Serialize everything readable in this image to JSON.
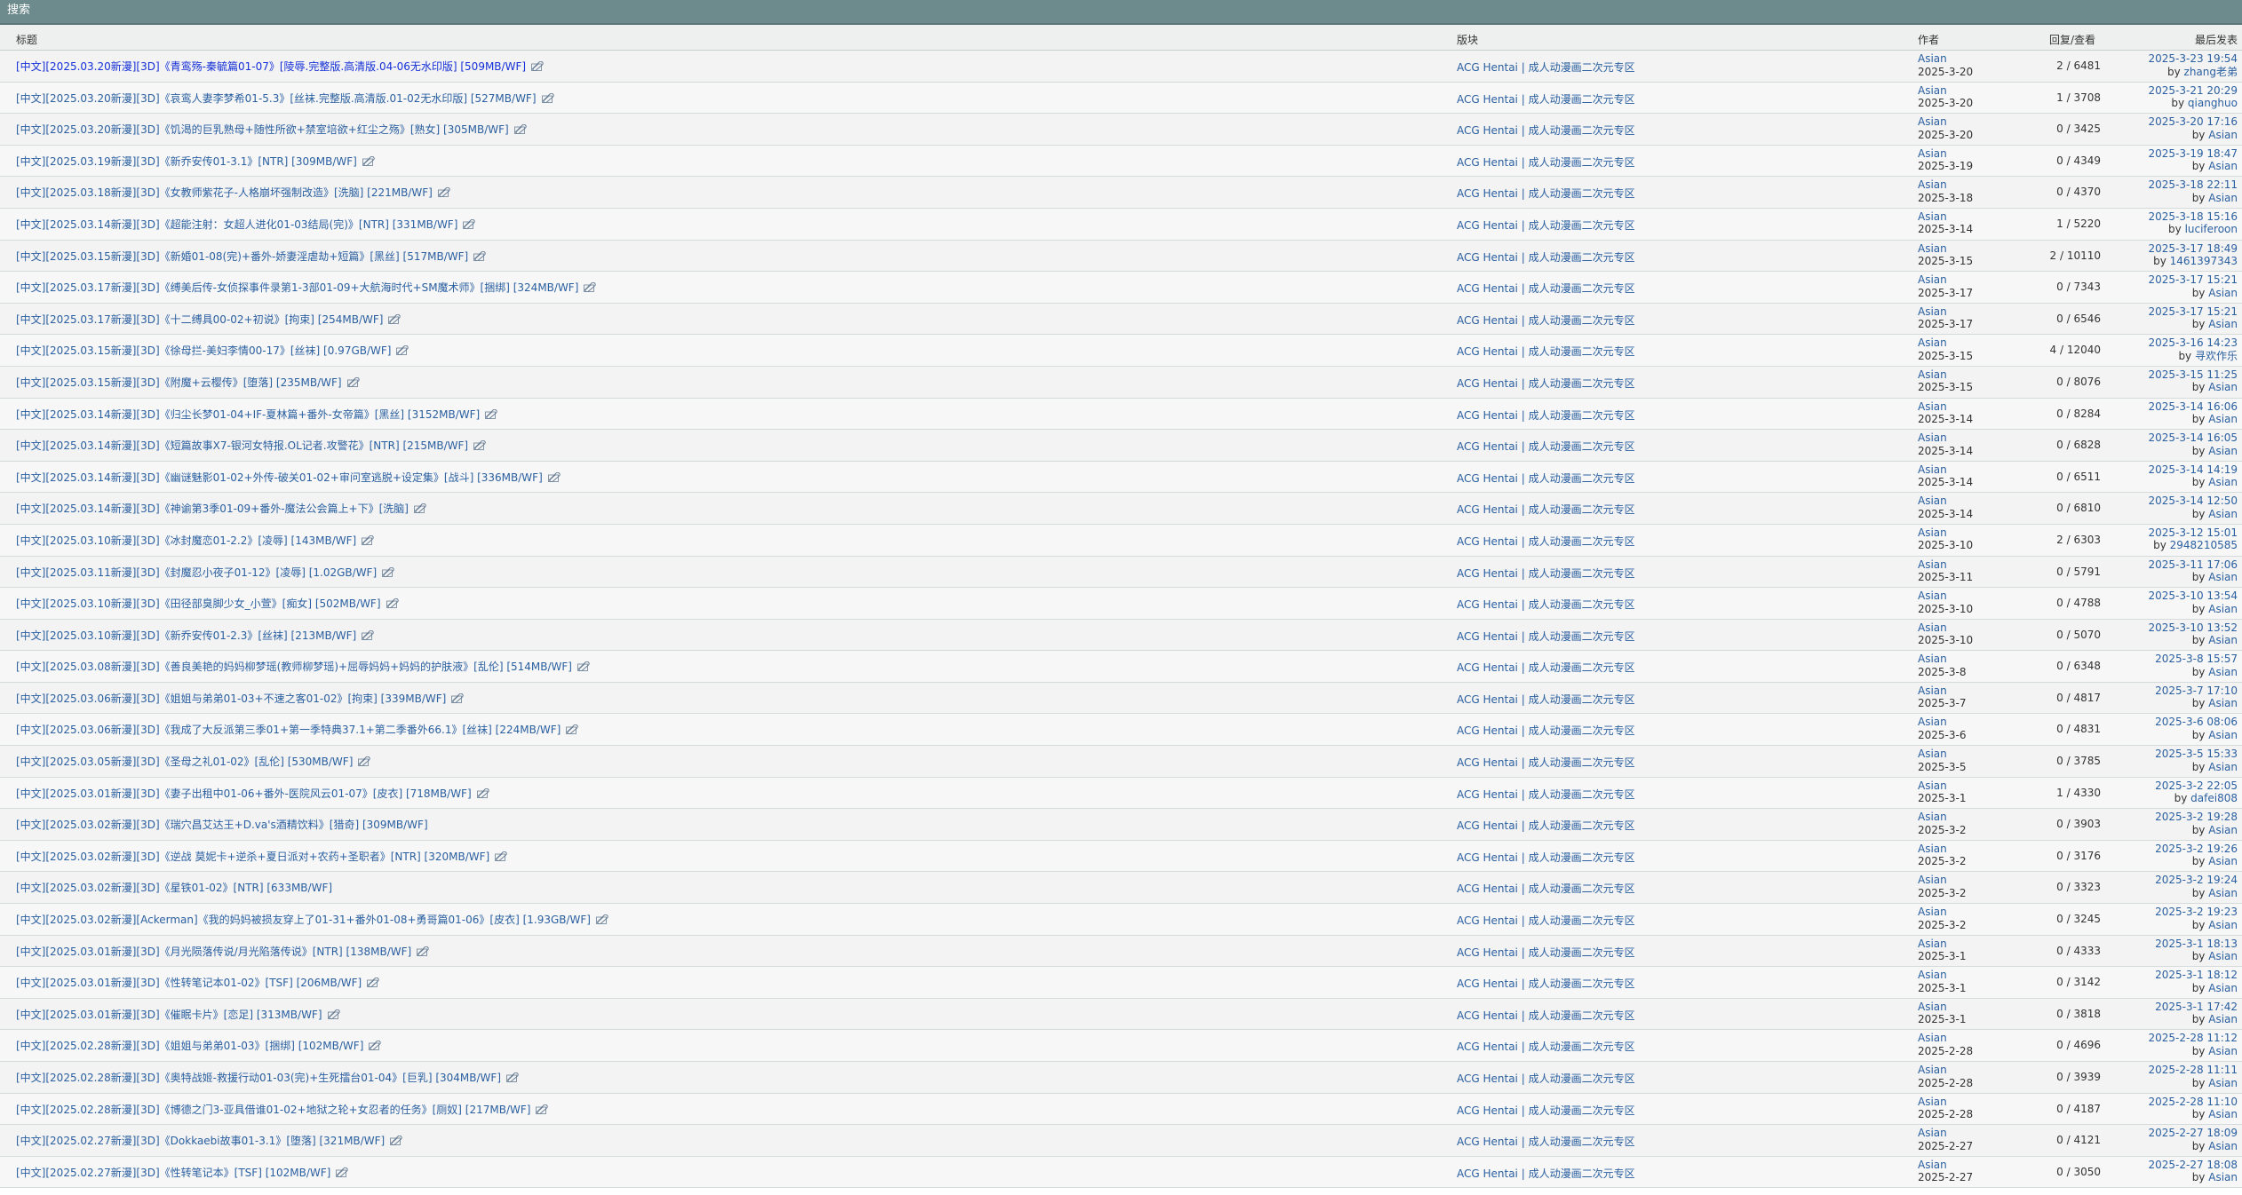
{
  "section_title": "搜索",
  "headers": {
    "title": "标题",
    "forum": "版块",
    "author": "作者",
    "stats": "回复/查看",
    "last": "最后发表"
  },
  "by_prefix": "by",
  "rows": [
    {
      "title": "[中文][2025.03.20新漫][3D]《青鸾殇-秦毓篇01-07》[陵辱.完整版.高清版.04-06无水印版] [509MB/WF]",
      "forum": "ACG Hentai | 成人动漫画二次元专区",
      "author": "Asian",
      "date": "2025-3-20",
      "stats": "2 / 6481",
      "last_date": "2025-3-23 19:54",
      "last_user": "zhang老弟",
      "clip": true
    },
    {
      "title": "[中文][2025.03.20新漫][3D]《哀鸾人妻李梦希01-5.3》[丝袜.完整版.高清版.01-02无水印版] [527MB/WF]",
      "forum": "ACG Hentai | 成人动漫画二次元专区",
      "author": "Asian",
      "date": "2025-3-20",
      "stats": "1 / 3708",
      "last_date": "2025-3-21 20:29",
      "last_user": "qianghuo",
      "clip": true
    },
    {
      "title": "[中文][2025.03.20新漫][3D]《饥渴的巨乳熟母+随性所欲+禁室培欲+红尘之殇》[熟女] [305MB/WF]",
      "forum": "ACG Hentai | 成人动漫画二次元专区",
      "author": "Asian",
      "date": "2025-3-20",
      "stats": "0 / 3425",
      "last_date": "2025-3-20 17:16",
      "last_user": "Asian",
      "clip": true
    },
    {
      "title": "[中文][2025.03.19新漫][3D]《新乔安传01-3.1》[NTR] [309MB/WF]",
      "forum": "ACG Hentai | 成人动漫画二次元专区",
      "author": "Asian",
      "date": "2025-3-19",
      "stats": "0 / 4349",
      "last_date": "2025-3-19 18:47",
      "last_user": "Asian",
      "clip": true
    },
    {
      "title": "[中文][2025.03.18新漫][3D]《女教师紫花子-人格崩坏强制改造》[洗脑] [221MB/WF]",
      "forum": "ACG Hentai | 成人动漫画二次元专区",
      "author": "Asian",
      "date": "2025-3-18",
      "stats": "0 / 4370",
      "last_date": "2025-3-18 22:11",
      "last_user": "Asian",
      "clip": true
    },
    {
      "title": "[中文][2025.03.14新漫][3D]《超能注射：女超人进化01-03结局(完)》[NTR] [331MB/WF]",
      "forum": "ACG Hentai | 成人动漫画二次元专区",
      "author": "Asian",
      "date": "2025-3-14",
      "stats": "1 / 5220",
      "last_date": "2025-3-18 15:16",
      "last_user": "luciferoon",
      "clip": true
    },
    {
      "title": "[中文][2025.03.15新漫][3D]《新婚01-08(完)+番外-娇妻淫虐劫+短篇》[黑丝] [517MB/WF]",
      "forum": "ACG Hentai | 成人动漫画二次元专区",
      "author": "Asian",
      "date": "2025-3-15",
      "stats": "2 / 10110",
      "last_date": "2025-3-17 18:49",
      "last_user": "1461397343",
      "clip": true
    },
    {
      "title": "[中文][2025.03.17新漫][3D]《缚美后传-女侦探事件录第1-3部01-09+大航海时代+SM魔术师》[捆绑] [324MB/WF]",
      "forum": "ACG Hentai | 成人动漫画二次元专区",
      "author": "Asian",
      "date": "2025-3-17",
      "stats": "0 / 7343",
      "last_date": "2025-3-17 15:21",
      "last_user": "Asian",
      "clip": true
    },
    {
      "title": "[中文][2025.03.17新漫][3D]《十二缚具00-02+初说》[拘束] [254MB/WF]",
      "forum": "ACG Hentai | 成人动漫画二次元专区",
      "author": "Asian",
      "date": "2025-3-17",
      "stats": "0 / 6546",
      "last_date": "2025-3-17 15:21",
      "last_user": "Asian",
      "clip": true
    },
    {
      "title": "[中文][2025.03.15新漫][3D]《徐母拦-美妇李情00-17》[丝袜] [0.97GB/WF]",
      "forum": "ACG Hentai | 成人动漫画二次元专区",
      "author": "Asian",
      "date": "2025-3-15",
      "stats": "4 / 12040",
      "last_date": "2025-3-16 14:23",
      "last_user": "寻欢作乐",
      "clip": true
    },
    {
      "title": "[中文][2025.03.15新漫][3D]《附魔+云樱传》[堕落] [235MB/WF]",
      "forum": "ACG Hentai | 成人动漫画二次元专区",
      "author": "Asian",
      "date": "2025-3-15",
      "stats": "0 / 8076",
      "last_date": "2025-3-15 11:25",
      "last_user": "Asian",
      "clip": true
    },
    {
      "title": "[中文][2025.03.14新漫][3D]《归尘长梦01-04+IF-夏林篇+番外-女帝篇》[黑丝] [3152MB/WF]",
      "forum": "ACG Hentai | 成人动漫画二次元专区",
      "author": "Asian",
      "date": "2025-3-14",
      "stats": "0 / 8284",
      "last_date": "2025-3-14 16:06",
      "last_user": "Asian",
      "clip": true
    },
    {
      "title": "[中文][2025.03.14新漫][3D]《短篇故事X7-银河女特报.OL记者.攻警花》[NTR] [215MB/WF]",
      "forum": "ACG Hentai | 成人动漫画二次元专区",
      "author": "Asian",
      "date": "2025-3-14",
      "stats": "0 / 6828",
      "last_date": "2025-3-14 16:05",
      "last_user": "Asian",
      "clip": true
    },
    {
      "title": "[中文][2025.03.14新漫][3D]《幽谜魅影01-02+外传-破关01-02+审问室逃脱+设定集》[战斗] [336MB/WF]",
      "forum": "ACG Hentai | 成人动漫画二次元专区",
      "author": "Asian",
      "date": "2025-3-14",
      "stats": "0 / 6511",
      "last_date": "2025-3-14 14:19",
      "last_user": "Asian",
      "clip": true
    },
    {
      "title": "[中文][2025.03.14新漫][3D]《神谕第3季01-09+番外-魔法公会篇上+下》[洗脑]",
      "forum": "ACG Hentai | 成人动漫画二次元专区",
      "author": "Asian",
      "date": "2025-3-14",
      "stats": "0 / 6810",
      "last_date": "2025-3-14 12:50",
      "last_user": "Asian",
      "clip": true
    },
    {
      "title": "[中文][2025.03.10新漫][3D]《冰封魔恋01-2.2》[凌辱] [143MB/WF]",
      "forum": "ACG Hentai | 成人动漫画二次元专区",
      "author": "Asian",
      "date": "2025-3-10",
      "stats": "2 / 6303",
      "last_date": "2025-3-12 15:01",
      "last_user": "2948210585",
      "clip": true
    },
    {
      "title": "[中文][2025.03.11新漫][3D]《封魔忍小夜子01-12》[凌辱] [1.02GB/WF]",
      "forum": "ACG Hentai | 成人动漫画二次元专区",
      "author": "Asian",
      "date": "2025-3-11",
      "stats": "0 / 5791",
      "last_date": "2025-3-11 17:06",
      "last_user": "Asian",
      "clip": true
    },
    {
      "title": "[中文][2025.03.10新漫][3D]《田径部臭脚少女_小萱》[痴女] [502MB/WF]",
      "forum": "ACG Hentai | 成人动漫画二次元专区",
      "author": "Asian",
      "date": "2025-3-10",
      "stats": "0 / 4788",
      "last_date": "2025-3-10 13:54",
      "last_user": "Asian",
      "clip": true
    },
    {
      "title": "[中文][2025.03.10新漫][3D]《新乔安传01-2.3》[丝袜] [213MB/WF]",
      "forum": "ACG Hentai | 成人动漫画二次元专区",
      "author": "Asian",
      "date": "2025-3-10",
      "stats": "0 / 5070",
      "last_date": "2025-3-10 13:52",
      "last_user": "Asian",
      "clip": true
    },
    {
      "title": "[中文][2025.03.08新漫][3D]《善良美艳的妈妈柳梦瑶(教师柳梦瑶)+屈辱妈妈+妈妈的护肤液》[乱伦] [514MB/WF]",
      "forum": "ACG Hentai | 成人动漫画二次元专区",
      "author": "Asian",
      "date": "2025-3-8",
      "stats": "0 / 6348",
      "last_date": "2025-3-8 15:57",
      "last_user": "Asian",
      "clip": true
    },
    {
      "title": "[中文][2025.03.06新漫][3D]《姐姐与弟弟01-03+不速之客01-02》[拘束] [339MB/WF]",
      "forum": "ACG Hentai | 成人动漫画二次元专区",
      "author": "Asian",
      "date": "2025-3-7",
      "stats": "0 / 4817",
      "last_date": "2025-3-7 17:10",
      "last_user": "Asian",
      "clip": true
    },
    {
      "title": "[中文][2025.03.06新漫][3D]《我成了大反派第三季01+第一季特典37.1+第二季番外66.1》[丝袜] [224MB/WF]",
      "forum": "ACG Hentai | 成人动漫画二次元专区",
      "author": "Asian",
      "date": "2025-3-6",
      "stats": "0 / 4831",
      "last_date": "2025-3-6 08:06",
      "last_user": "Asian",
      "clip": true
    },
    {
      "title": "[中文][2025.03.05新漫][3D]《圣母之礼01-02》[乱伦] [530MB/WF]",
      "forum": "ACG Hentai | 成人动漫画二次元专区",
      "author": "Asian",
      "date": "2025-3-5",
      "stats": "0 / 3785",
      "last_date": "2025-3-5 15:33",
      "last_user": "Asian",
      "clip": true
    },
    {
      "title": "[中文][2025.03.01新漫][3D]《妻子出租中01-06+番外-医院风云01-07》[皮衣] [718MB/WF]",
      "forum": "ACG Hentai | 成人动漫画二次元专区",
      "author": "Asian",
      "date": "2025-3-1",
      "stats": "1 / 4330",
      "last_date": "2025-3-2 22:05",
      "last_user": "dafei808",
      "clip": true
    },
    {
      "title": "[中文][2025.03.02新漫][3D]《瑞穴昌艾达王+D.va's酒精饮料》[猎奇] [309MB/WF]",
      "forum": "ACG Hentai | 成人动漫画二次元专区",
      "author": "Asian",
      "date": "2025-3-2",
      "stats": "0 / 3903",
      "last_date": "2025-3-2 19:28",
      "last_user": "Asian",
      "clip": false
    },
    {
      "title": "[中文][2025.03.02新漫][3D]《逆战 莫妮卡+逆杀+夏日派对+农药+圣职者》[NTR] [320MB/WF]",
      "forum": "ACG Hentai | 成人动漫画二次元专区",
      "author": "Asian",
      "date": "2025-3-2",
      "stats": "0 / 3176",
      "last_date": "2025-3-2 19:26",
      "last_user": "Asian",
      "clip": true
    },
    {
      "title": "[中文][2025.03.02新漫][3D]《星铁01-02》[NTR] [633MB/WF]",
      "forum": "ACG Hentai | 成人动漫画二次元专区",
      "author": "Asian",
      "date": "2025-3-2",
      "stats": "0 / 3323",
      "last_date": "2025-3-2 19:24",
      "last_user": "Asian",
      "clip": false
    },
    {
      "title": "[中文][2025.03.02新漫][Ackerman]《我的妈妈被损友穿上了01-31+番外01-08+勇哥篇01-06》[皮衣] [1.93GB/WF]",
      "forum": "ACG Hentai | 成人动漫画二次元专区",
      "author": "Asian",
      "date": "2025-3-2",
      "stats": "0 / 3245",
      "last_date": "2025-3-2 19:23",
      "last_user": "Asian",
      "clip": true
    },
    {
      "title": "[中文][2025.03.01新漫][3D]《月光陨落传说/月光陷落传说》[NTR] [138MB/WF]",
      "forum": "ACG Hentai | 成人动漫画二次元专区",
      "author": "Asian",
      "date": "2025-3-1",
      "stats": "0 / 4333",
      "last_date": "2025-3-1 18:13",
      "last_user": "Asian",
      "clip": true
    },
    {
      "title": "[中文][2025.03.01新漫][3D]《性转笔记本01-02》[TSF] [206MB/WF]",
      "forum": "ACG Hentai | 成人动漫画二次元专区",
      "author": "Asian",
      "date": "2025-3-1",
      "stats": "0 / 3142",
      "last_date": "2025-3-1 18:12",
      "last_user": "Asian",
      "clip": true
    },
    {
      "title": "[中文][2025.03.01新漫][3D]《催眠卡片》[恋足] [313MB/WF]",
      "forum": "ACG Hentai | 成人动漫画二次元专区",
      "author": "Asian",
      "date": "2025-3-1",
      "stats": "0 / 3818",
      "last_date": "2025-3-1 17:42",
      "last_user": "Asian",
      "clip": true
    },
    {
      "title": "[中文][2025.02.28新漫][3D]《姐姐与弟弟01-03》[捆绑] [102MB/WF]",
      "forum": "ACG Hentai | 成人动漫画二次元专区",
      "author": "Asian",
      "date": "2025-2-28",
      "stats": "0 / 4696",
      "last_date": "2025-2-28 11:12",
      "last_user": "Asian",
      "clip": true
    },
    {
      "title": "[中文][2025.02.28新漫][3D]《奥特战姬-救援行动01-03(完)+生死擂台01-04》[巨乳] [304MB/WF]",
      "forum": "ACG Hentai | 成人动漫画二次元专区",
      "author": "Asian",
      "date": "2025-2-28",
      "stats": "0 / 3939",
      "last_date": "2025-2-28 11:11",
      "last_user": "Asian",
      "clip": true
    },
    {
      "title": "[中文][2025.02.28新漫][3D]《博德之门3-亚具借谁01-02+地狱之轮+女忍者的任务》[厕奴] [217MB/WF]",
      "forum": "ACG Hentai | 成人动漫画二次元专区",
      "author": "Asian",
      "date": "2025-2-28",
      "stats": "0 / 4187",
      "last_date": "2025-2-28 11:10",
      "last_user": "Asian",
      "clip": true
    },
    {
      "title": "[中文][2025.02.27新漫][3D]《Dokkaebi故事01-3.1》[堕落] [321MB/WF]",
      "forum": "ACG Hentai | 成人动漫画二次元专区",
      "author": "Asian",
      "date": "2025-2-27",
      "stats": "0 / 4121",
      "last_date": "2025-2-27 18:09",
      "last_user": "Asian",
      "clip": true
    },
    {
      "title": "[中文][2025.02.27新漫][3D]《性转笔记本》[TSF] [102MB/WF]",
      "forum": "ACG Hentai | 成人动漫画二次元专区",
      "author": "Asian",
      "date": "2025-2-27",
      "stats": "0 / 3050",
      "last_date": "2025-2-27 18:08",
      "last_user": "Asian",
      "clip": true
    }
  ]
}
